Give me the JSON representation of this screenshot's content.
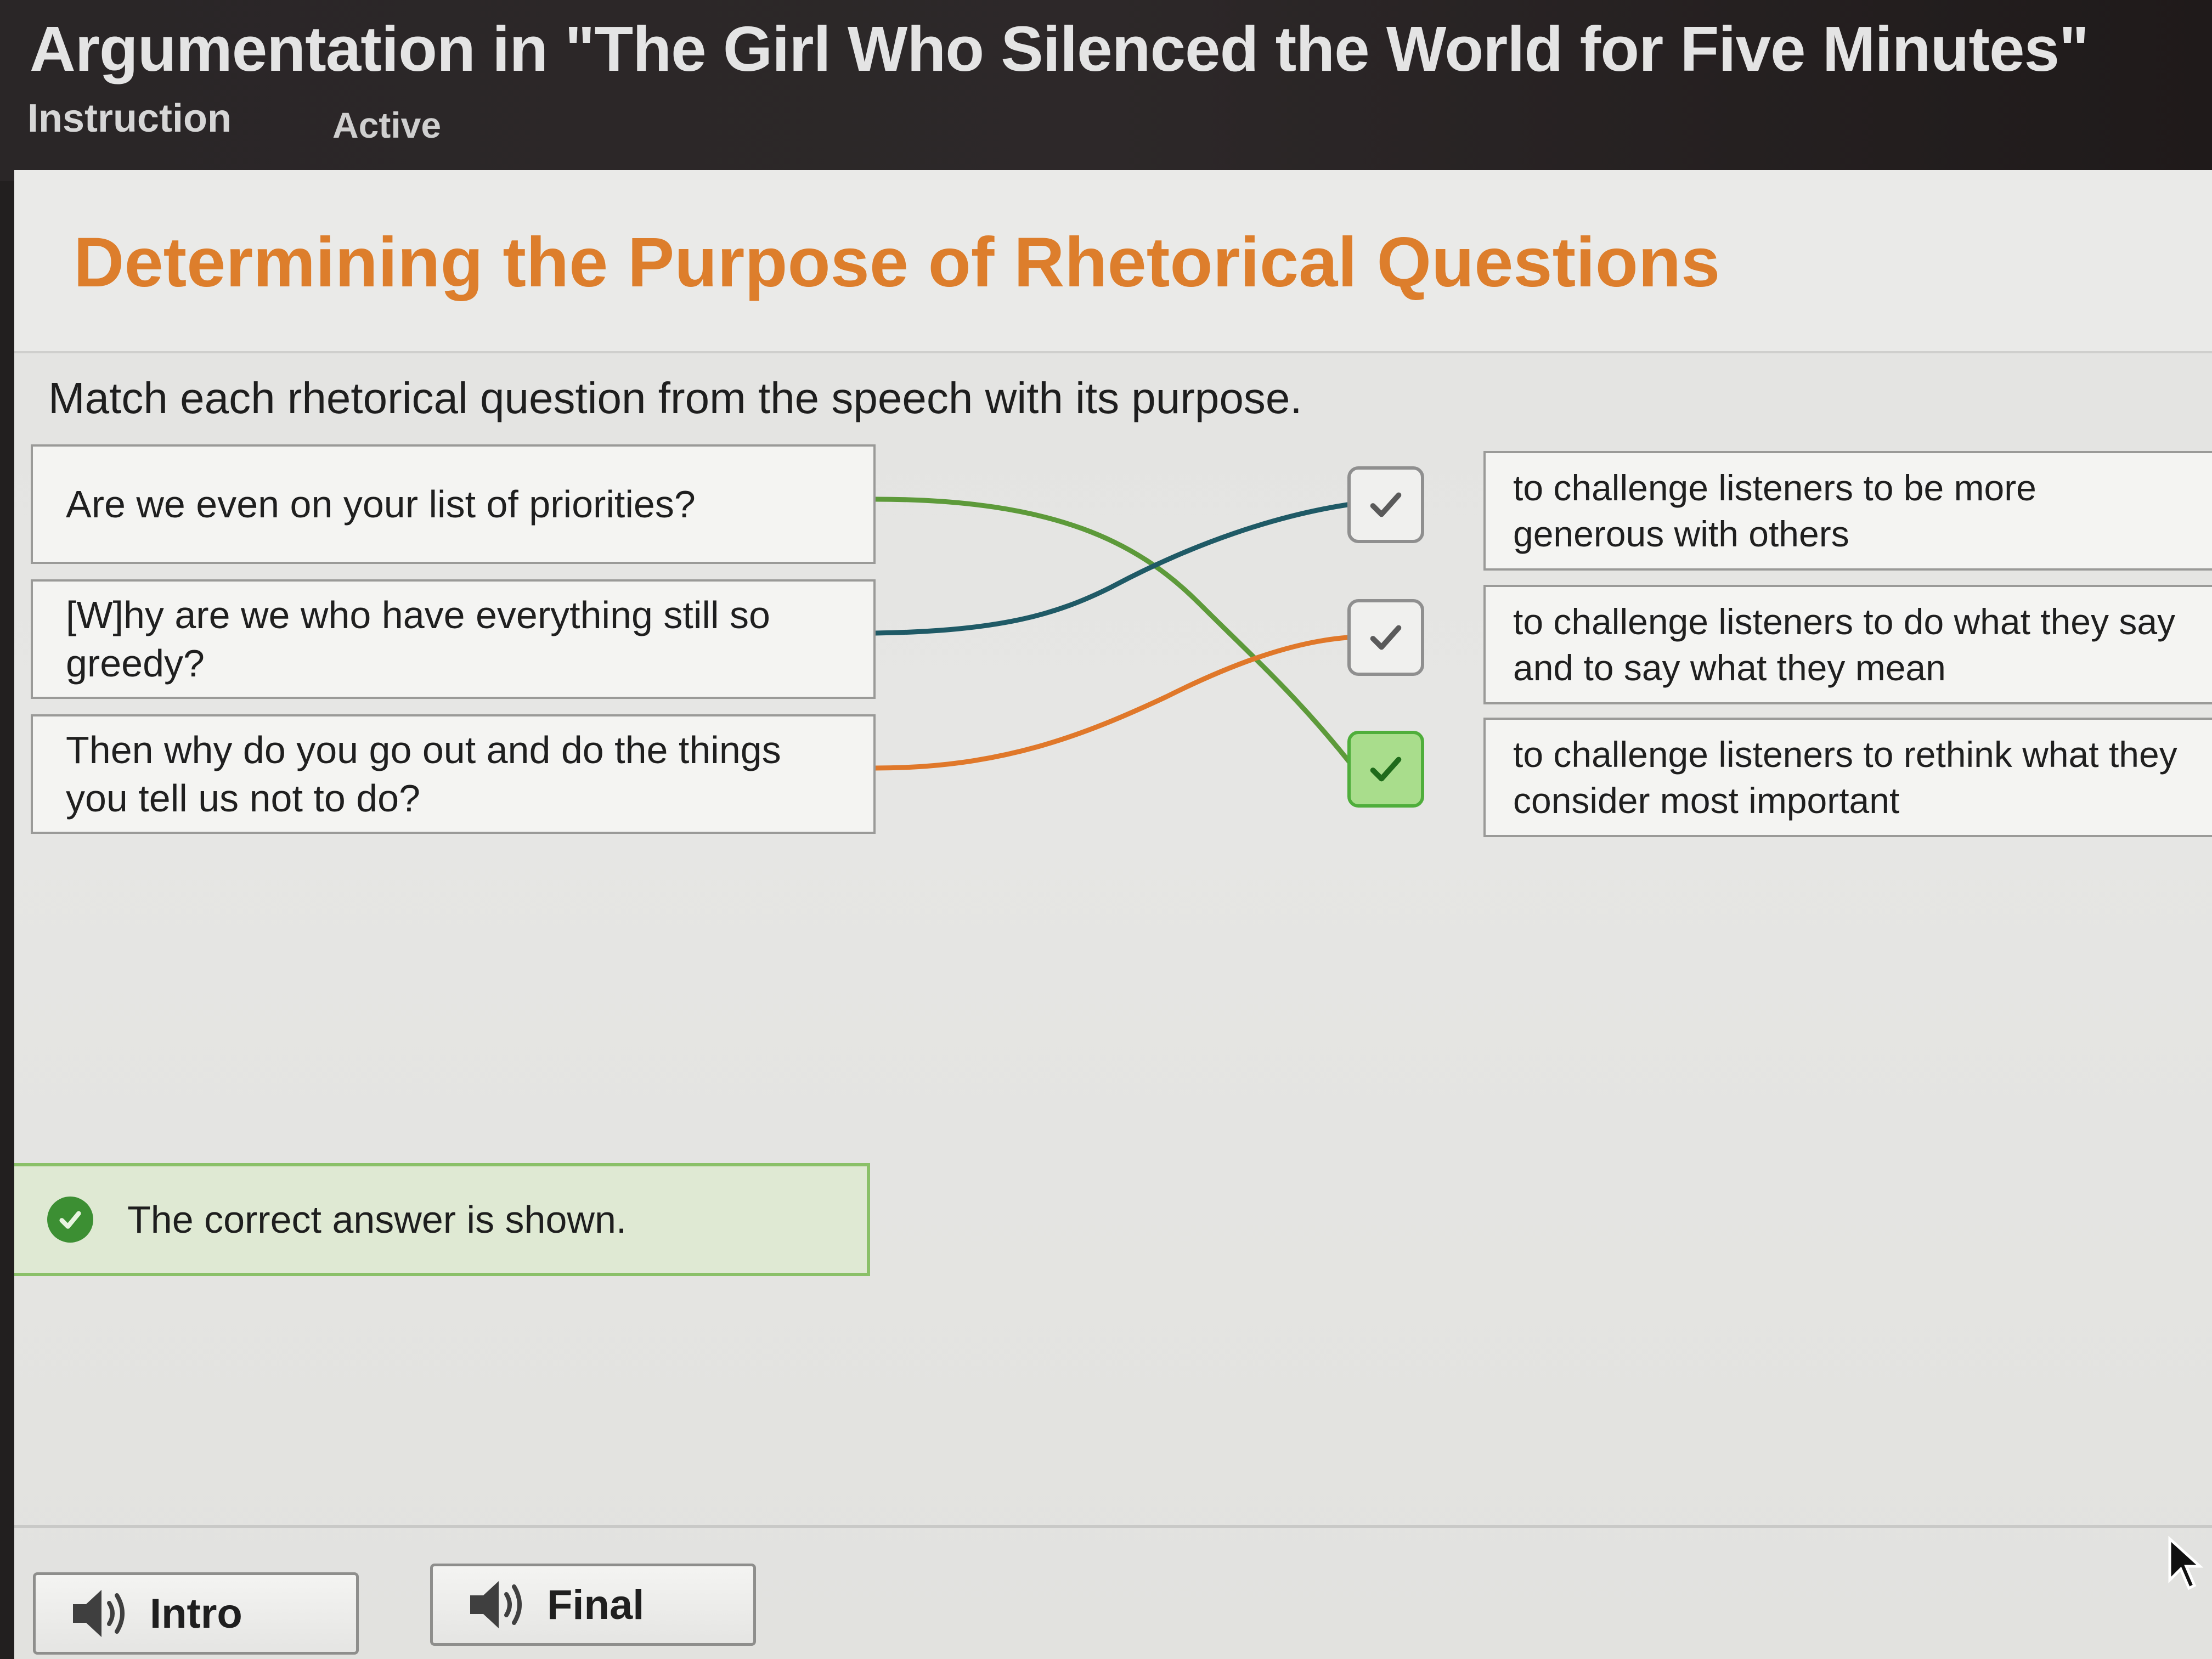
{
  "header": {
    "title": "Argumentation in \"The Girl Who Silenced the World for Five Minutes\"",
    "tabs": [
      "Instruction",
      "Active"
    ]
  },
  "activity": {
    "title": "Determining the Purpose of Rhetorical Questions",
    "instructions": "Match each rhetorical question from the speech with its purpose.",
    "questions": [
      "Are we even on your list of priorities?",
      "[W]hy are we who have everything still so greedy?",
      "Then why do you go out and do the things you tell us not to do?"
    ],
    "purposes": [
      "to challenge listeners to be more generous with others",
      "to challenge listeners to do what they say and to say what they mean",
      "to challenge listeners to rethink what they consider most important"
    ],
    "matches": [
      {
        "question": 0,
        "purpose": 2,
        "color": "#5d9a3a"
      },
      {
        "question": 1,
        "purpose": 0,
        "color": "#1f5a66"
      },
      {
        "question": 2,
        "purpose": 1,
        "color": "#e0782a"
      }
    ],
    "check_icons": [
      "check-icon",
      "check-icon",
      "check-icon"
    ]
  },
  "feedback": {
    "text": "The correct answer is shown.",
    "icon": "check-circle-icon",
    "color": "#3c8f33"
  },
  "footer": {
    "buttons": [
      {
        "label": "Intro",
        "icon": "speaker-icon"
      },
      {
        "label": "Final",
        "icon": "speaker-icon"
      }
    ]
  },
  "colors": {
    "accent": "#dd7e2c",
    "correct": "#4fae3b"
  }
}
